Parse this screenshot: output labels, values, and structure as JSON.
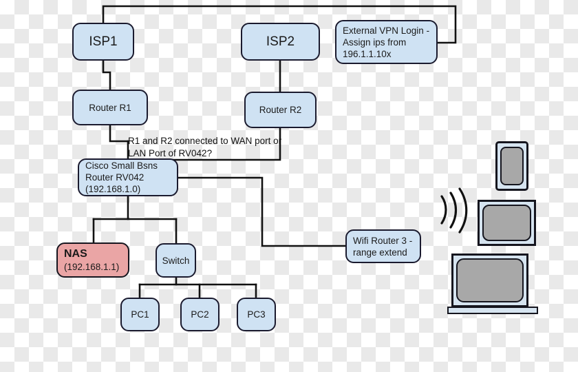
{
  "diagram": {
    "title": "Home network topology with dual ISP, Cisco RV042 router, NAS, switch and wireless clients",
    "colors": {
      "node_fill": "#cfe2f3",
      "node_stroke": "#1a1a2e",
      "nas_fill": "#eaa5a5",
      "line": "#111111",
      "device_body": "#d6e4f0",
      "device_screen": "#a8a8a8"
    },
    "nodes": [
      {
        "id": "isp1",
        "label": "ISP1"
      },
      {
        "id": "isp2",
        "label": "ISP2"
      },
      {
        "id": "vpn",
        "label": "External VPN Login -\nAssign ips from\n196.1.1.10x"
      },
      {
        "id": "router1",
        "label": "Router R1"
      },
      {
        "id": "router2",
        "label": "Router R2"
      },
      {
        "id": "rv042",
        "label": "Cisco Small Bsns\nRouter RV042\n(192.168.1.0)"
      },
      {
        "id": "nas",
        "title": "NAS",
        "subtitle": "(192.168.1.1)"
      },
      {
        "id": "switch",
        "label": "Switch"
      },
      {
        "id": "pc1",
        "label": "PC1"
      },
      {
        "id": "pc2",
        "label": "PC2"
      },
      {
        "id": "pc3",
        "label": "PC3"
      },
      {
        "id": "wifi3",
        "label": "Wifi Router 3 -\nrange extend"
      }
    ],
    "annotations": [
      {
        "id": "wan-lan-question",
        "text": "R1 and R2 connected to WAN port or\nLAN Port of RV042?"
      }
    ],
    "devices": [
      {
        "id": "phone",
        "label": "smartphone"
      },
      {
        "id": "monitor",
        "label": "tablet-monitor"
      },
      {
        "id": "laptop",
        "label": "laptop"
      },
      {
        "id": "waves",
        "label": "wireless-signal"
      }
    ],
    "links": [
      {
        "from": "isp1",
        "to": "vpn"
      },
      {
        "from": "isp1",
        "to": "router1"
      },
      {
        "from": "isp2",
        "to": "router2"
      },
      {
        "from": "router1",
        "to": "rv042"
      },
      {
        "from": "router2",
        "to": "rv042"
      },
      {
        "from": "rv042",
        "to": "nas"
      },
      {
        "from": "rv042",
        "to": "switch"
      },
      {
        "from": "rv042",
        "to": "wifi3"
      },
      {
        "from": "switch",
        "to": "pc1"
      },
      {
        "from": "switch",
        "to": "pc2"
      },
      {
        "from": "switch",
        "to": "pc3"
      }
    ]
  }
}
